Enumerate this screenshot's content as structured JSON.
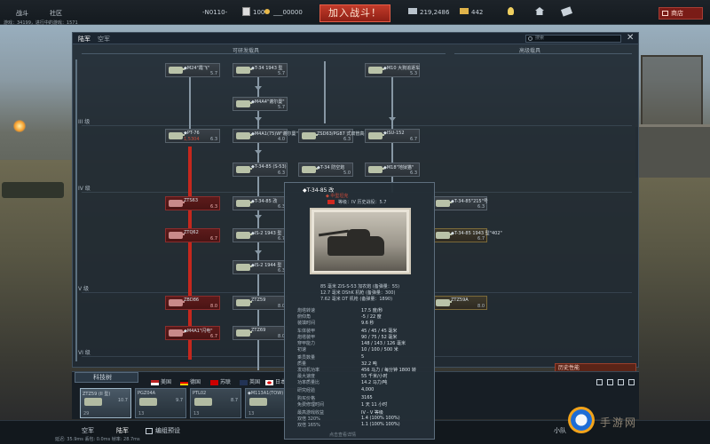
{
  "topbar": {
    "battle": "战斗",
    "clan": "社区",
    "player": "-N0110-",
    "premium": "100",
    "xp": "___00000",
    "join": "加入战斗！",
    "silver": "219,2486",
    "gold": "442",
    "shop": "商店"
  },
  "subline": "游戏：34199，进行中的游戏：1571",
  "window": {
    "tab_ground": "陆军",
    "tab_air": "空军",
    "search_placeholder": "搜索"
  },
  "sections": {
    "research": "可研发载具",
    "premium": "高级载具"
  },
  "ranks": {
    "r3": "III 级",
    "r4": "IV 级",
    "r5": "V 级",
    "r6": "VI 级"
  },
  "cards": [
    {
      "name": "◆M24\"霞飞\"",
      "br": "5.7",
      "style": "grey"
    },
    {
      "name": "◆T-34 1943 型",
      "br": "5.7",
      "style": "grey"
    },
    {
      "name": "◆M10 大狗追逐车",
      "br": "5.3",
      "style": "grey"
    },
    {
      "name": "◆M4A4\"谢尔曼\"",
      "br": "5.7",
      "style": "grey"
    },
    {
      "name": "◆PT-76",
      "br": "6.3",
      "style": "grey",
      "pct": "1,5304"
    },
    {
      "name": "◆M4A1(75)W\"谢尔曼\"",
      "br": "4.0",
      "style": "grey"
    },
    {
      "name": "ZSD63/PG87 式双管高射炮",
      "br": "6.3",
      "style": "grey"
    },
    {
      "name": "◆ISU-152",
      "br": "6.7",
      "style": "grey"
    },
    {
      "name": "◆T-34-85 (S-53)",
      "br": "6.3",
      "style": "grey"
    },
    {
      "name": "◆T-34 防空炮",
      "br": "5.0",
      "style": "grey"
    },
    {
      "name": "◆M18\"地狱猫\"",
      "br": "6.3",
      "style": "grey"
    },
    {
      "name": "ZTS63",
      "br": "6.3",
      "style": "red"
    },
    {
      "name": "◆T-34-85 改",
      "br": "6.3",
      "style": "grey"
    },
    {
      "name": "◆T-34-85\"215\"号",
      "br": "6.3",
      "style": "grey"
    },
    {
      "name": "ZTQ62",
      "br": "6.7",
      "style": "red"
    },
    {
      "name": "◆IS-2 1943 型",
      "br": "6.7",
      "style": "grey"
    },
    {
      "name": "◆T-34-85 1943 型\"402\"",
      "br": "6.7",
      "style": "orange"
    },
    {
      "name": "◆IS-2 1944 型",
      "br": "6.3",
      "style": "grey"
    },
    {
      "name": "ZBD86",
      "br": "8.0",
      "style": "red"
    },
    {
      "name": "ZTZ59",
      "br": "8.0",
      "style": "grey"
    },
    {
      "name": "ZTZ59A",
      "br": "8.0",
      "style": "orange"
    },
    {
      "name": "◆M4A1\"闪电\"",
      "br": "6.7",
      "style": "red"
    },
    {
      "name": "ZTZ69",
      "br": "8.0",
      "style": "grey"
    }
  ],
  "tooltip": {
    "title": "◆T-34-85 改",
    "subtitle": "◆ 中型坦克",
    "rank": "等级：IV  历史战役：5.7",
    "weapons": [
      "85 毫米 ZiS-S-53 加农炮 (备弹量：55)",
      "12.7 毫米 DShK 机枪 (备弹量：300)",
      "7.62 毫米 DT 机枪 (备弹量：1890)"
    ],
    "stats": [
      {
        "label": "炮塔转速",
        "value": "17.5 度/秒"
      },
      {
        "label": "俯仰角",
        "value": "-5 / 22 度"
      },
      {
        "label": "装填时间",
        "value": "9.6 秒"
      },
      {
        "label": "车体装甲",
        "value": "45 / 45 / 45 毫米"
      },
      {
        "label": "炮塔装甲",
        "value": "90 / 75 / 52 毫米"
      },
      {
        "label": "穿甲能力",
        "value": "148 / 143 / 126 毫米"
      },
      {
        "label": "初速",
        "value": "10 / 100 / 500 米"
      },
      {
        "label": "乘员数量",
        "value": "5"
      },
      {
        "label": "质量",
        "value": "32.2 吨"
      },
      {
        "label": "发动机功率",
        "value": "456 马力 / 每分钟 1800 转"
      },
      {
        "label": "最大速度",
        "value": "55 千米/小时"
      },
      {
        "label": "功率质量比",
        "value": "14.2 马力/吨"
      },
      {
        "label": "研究经验",
        "value": "4,000"
      },
      {
        "label": "购买价格",
        "value": "3165"
      },
      {
        "label": "免费修理时间",
        "value": "1 天 11 小时"
      },
      {
        "label": "最高游戏收益",
        "value": "IV - V 等级"
      },
      {
        "label": "双倍 320%",
        "value": "1.4 (100% 100%)"
      },
      {
        "label": "双倍 165%",
        "value": "1.1 (100% 100%)"
      }
    ],
    "footer": "点击查看详情"
  },
  "nations": [
    "美国",
    "德国",
    "苏联",
    "英国",
    "日本"
  ],
  "tech_label": "科技树",
  "slots": [
    {
      "name": "ZTZ59 (II 型)",
      "br": "10.7",
      "crew": "29"
    },
    {
      "name": "PGZ04A",
      "br": "9.7",
      "crew": "13"
    },
    {
      "name": "PTL02",
      "br": "8.7",
      "crew": "13"
    },
    {
      "name": "◆M113A1(TOW)",
      "br": "8.3",
      "crew": "13"
    }
  ],
  "history_label": "历史性能",
  "bottombar": {
    "air": "空军",
    "ground": "陆军",
    "preset": "编组预设",
    "squad": "小队"
  },
  "fps": "延迟: 35.9ms 丢包: 0.0ms 帧率: 28.7ms",
  "watermark": "手游网"
}
